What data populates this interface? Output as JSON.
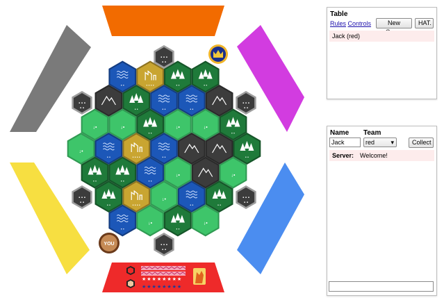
{
  "table_panel": {
    "title": "Table",
    "links": {
      "rules": "Rules",
      "controls": "Controls"
    },
    "buttons": {
      "new_game": "New Game",
      "hat": "HAT."
    },
    "players": [
      "Jack (red)"
    ]
  },
  "lobby_panel": {
    "name_header": "Name",
    "team_header": "Team",
    "name_value": "Jack",
    "team_value": "red",
    "collect_label": "Collect",
    "chat": [
      {
        "sender": "Server:",
        "text": "Welcome!"
      }
    ],
    "chat_input_value": ""
  },
  "board": {
    "player_colors": {
      "top": "#f26b00",
      "top_right": "#d23ce0",
      "bottom_right": "#4b8df0",
      "bottom": "#ee2a2a",
      "bottom_left": "#f7df41",
      "top_left": "#7a7a7a"
    },
    "terrain_colors": {
      "water": "#1c57b8",
      "forest": "#1f7a3a",
      "field": "#3ec56a",
      "mountain": "#3c3c3c",
      "desert": "#c9a531"
    },
    "you_badge": "YOU",
    "rows": [
      [
        "water",
        "desert",
        "forest",
        "forest"
      ],
      [
        "mountain",
        "forest",
        "water",
        "water",
        "mountain"
      ],
      [
        "field",
        "field",
        "forest",
        "field",
        "field",
        "forest"
      ],
      [
        "field",
        "water",
        "desert",
        "water",
        "mountain",
        "mountain",
        "forest"
      ],
      [
        "forest",
        "forest",
        "water",
        "field",
        "mountain",
        "field"
      ],
      [
        "forest",
        "desert",
        "field",
        "water",
        "forest"
      ],
      [
        "water",
        "field",
        "forest",
        "field"
      ]
    ]
  }
}
